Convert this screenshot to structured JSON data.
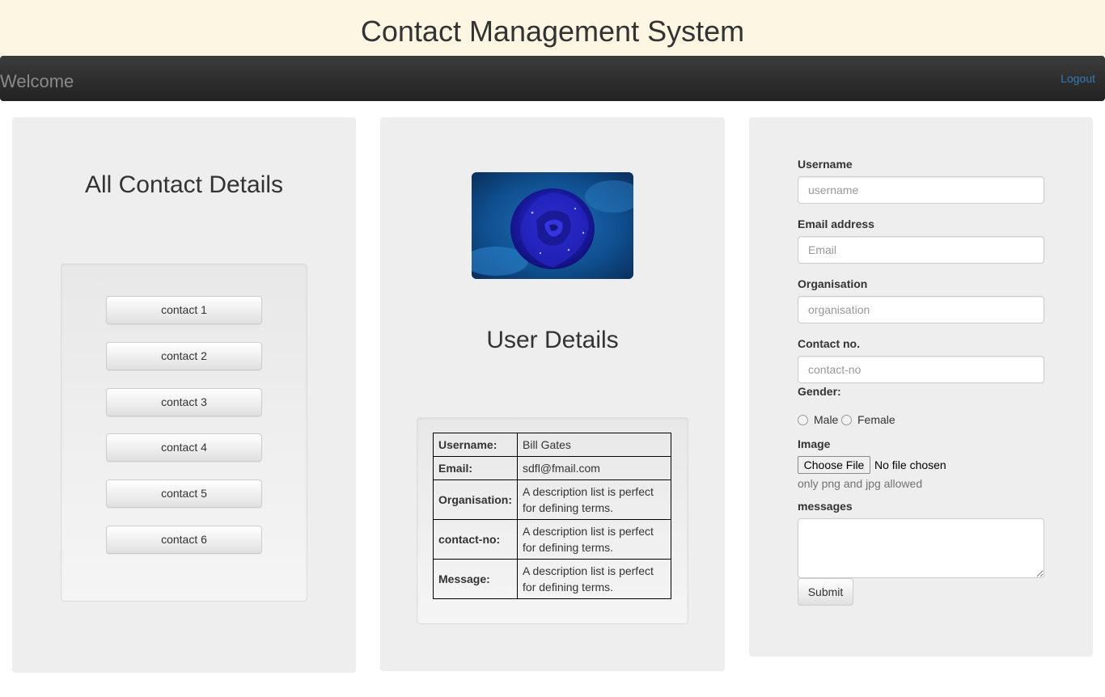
{
  "header": {
    "title": "Contact Management System"
  },
  "navbar": {
    "brand": "Welcome",
    "logout_label": "Logout",
    "link_color": "#337ab7"
  },
  "contacts_panel": {
    "title": "All Contact Details",
    "contacts": [
      "contact 1",
      "contact 2",
      "contact 3",
      "contact 4",
      "contact 5",
      "contact 6"
    ]
  },
  "details_panel": {
    "image_icon": "blue-rose-photo",
    "title": "User Details",
    "rows": [
      {
        "key": "Username:",
        "value": "Bill Gates"
      },
      {
        "key": "Email:",
        "value": "sdfl@fmail.com"
      },
      {
        "key": "Organisation:",
        "value": "A description list is perfect for defining terms."
      },
      {
        "key": "contact-no:",
        "value": "A description list is perfect for defining terms."
      },
      {
        "key": "Message:",
        "value": "A description list is perfect for defining terms."
      }
    ]
  },
  "form": {
    "username_label": "Username",
    "username_placeholder": "username",
    "email_label": "Email address",
    "email_placeholder": "Email",
    "organisation_label": "Organisation",
    "organisation_placeholder": "organisation",
    "contact_label": "Contact no.",
    "contact_placeholder": "contact-no",
    "gender_label": "Gender:",
    "gender_male": "Male",
    "gender_female": "Female",
    "image_label": "Image",
    "file_button": "Choose File",
    "file_status": "No file chosen",
    "image_help": "only png and jpg allowed",
    "messages_label": "messages",
    "submit_label": "Submit"
  }
}
